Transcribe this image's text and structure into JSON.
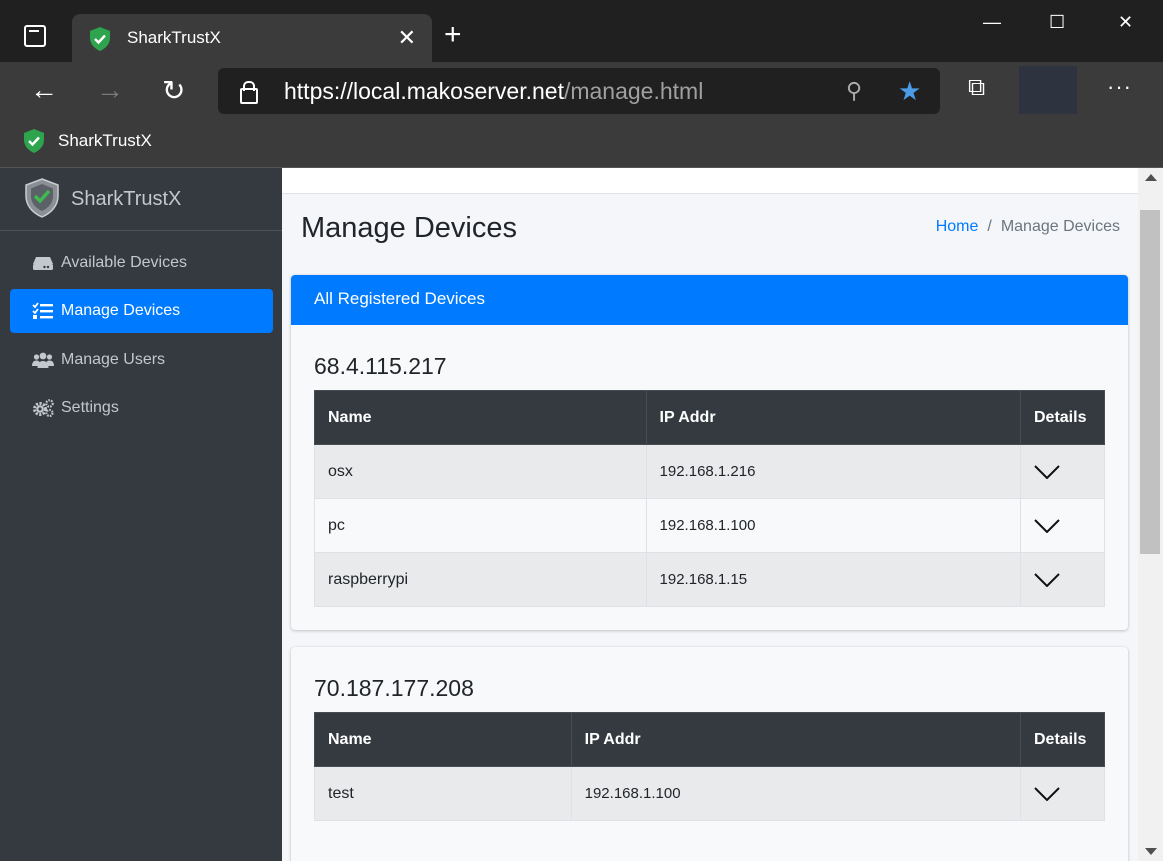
{
  "browser": {
    "tab_title": "SharkTrustX",
    "tab_close": "✕",
    "new_tab": "+",
    "url_host": "https://local.makoserver.net",
    "url_path": "/manage.html",
    "minimize": "—",
    "maximize": "☐",
    "close": "✕",
    "back": "←",
    "forward": "→",
    "refresh": "↻",
    "zoom_icon": "⚲",
    "favorite_icon": "★",
    "collections_icon": "⧉",
    "more": "···",
    "favorites_bar_item": "SharkTrustX"
  },
  "sidebar": {
    "brand": "SharkTrustX",
    "items": [
      {
        "label": "Available Devices",
        "icon": "hdd-icon",
        "active": false
      },
      {
        "label": "Manage Devices",
        "icon": "tasks-icon",
        "active": true
      },
      {
        "label": "Manage Users",
        "icon": "users-icon",
        "active": false
      },
      {
        "label": "Settings",
        "icon": "cogs-icon",
        "active": false
      }
    ]
  },
  "main": {
    "title": "Manage Devices",
    "breadcrumb": {
      "home": "Home",
      "separator": "/",
      "current": "Manage Devices"
    },
    "card_header": "All Registered Devices",
    "columns": {
      "name": "Name",
      "ip": "IP Addr",
      "details": "Details"
    },
    "groups": [
      {
        "ip": "68.4.115.217",
        "devices": [
          {
            "name": "osx",
            "ip": "192.168.1.216"
          },
          {
            "name": "pc",
            "ip": "192.168.1.100"
          },
          {
            "name": "raspberrypi",
            "ip": "192.168.1.15"
          }
        ]
      },
      {
        "ip": "70.187.177.208",
        "devices": [
          {
            "name": "test",
            "ip": "192.168.1.100"
          }
        ]
      }
    ]
  },
  "colors": {
    "accent": "#007bff",
    "sidebar_bg": "#343a40",
    "shield_green": "#2ea44f"
  }
}
